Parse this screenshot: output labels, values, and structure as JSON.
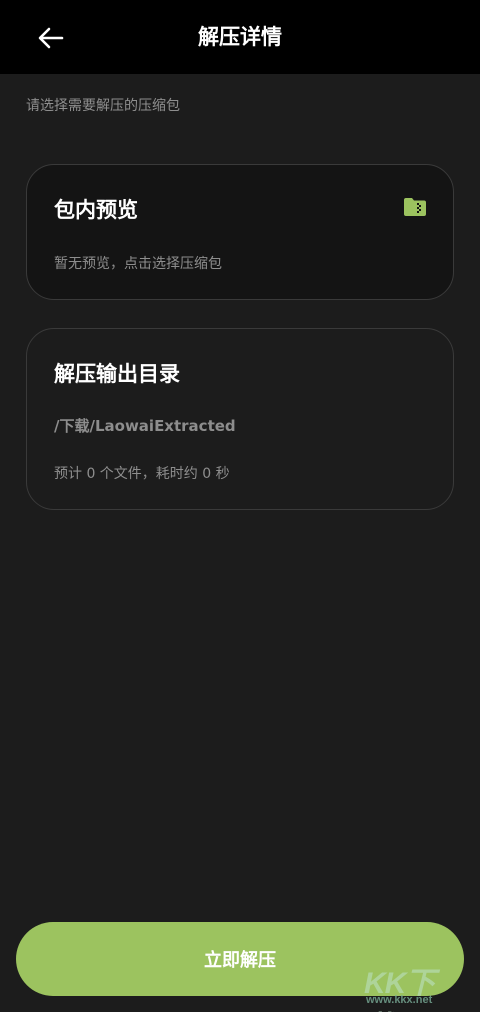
{
  "app_bar": {
    "title": "解压详情",
    "back_icon": "arrow-left-icon"
  },
  "hint": "请选择需要解压的压缩包",
  "preview_card": {
    "title": "包内预览",
    "empty_text": "暂无预览，点击选择压缩包",
    "icon": "zip-folder-icon"
  },
  "output_card": {
    "title": "解压输出目录",
    "path": "/下载/LaowaiExtracted",
    "estimate": "预计 0 个文件，耗时约 0 秒"
  },
  "action": {
    "label": "立即解压"
  },
  "watermark": {
    "brand": "KK下载",
    "url": "www.kkx.net"
  },
  "colors": {
    "app_bar_bg": "#000000",
    "page_bg": "#1c1c1c",
    "accent": "#9cc35f",
    "muted_text": "#8e8e8e"
  }
}
